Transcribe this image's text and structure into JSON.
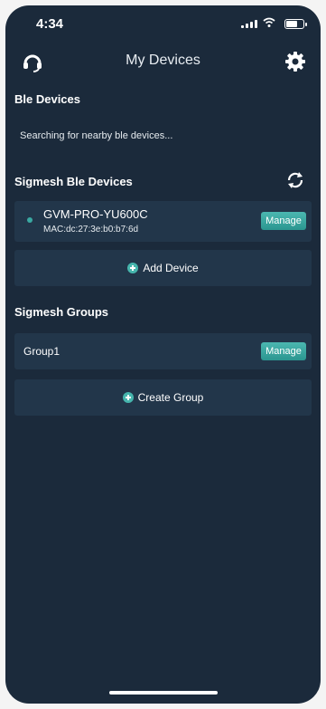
{
  "status_bar": {
    "time": "4:34"
  },
  "nav": {
    "title": "My Devices",
    "left_icon": "headset-icon",
    "right_icon": "gear-icon"
  },
  "ble_section": {
    "title": "Ble Devices",
    "status_text": "Searching for nearby ble devices..."
  },
  "sigmesh_devices": {
    "title": "Sigmesh Ble Devices",
    "refresh_icon": "refresh-icon",
    "devices": [
      {
        "name": "GVM-PRO-YU600C",
        "mac": "MAC:dc:27:3e:b0:b7:6d",
        "manage_label": "Manage"
      }
    ],
    "add_label": "Add Device"
  },
  "sigmesh_groups": {
    "title": "Sigmesh Groups",
    "groups": [
      {
        "name": "Group1",
        "manage_label": "Manage"
      }
    ],
    "create_label": "Create Group"
  },
  "colors": {
    "background": "#1b2a3b",
    "card": "#22364a",
    "accent": "#3aa9a2"
  }
}
